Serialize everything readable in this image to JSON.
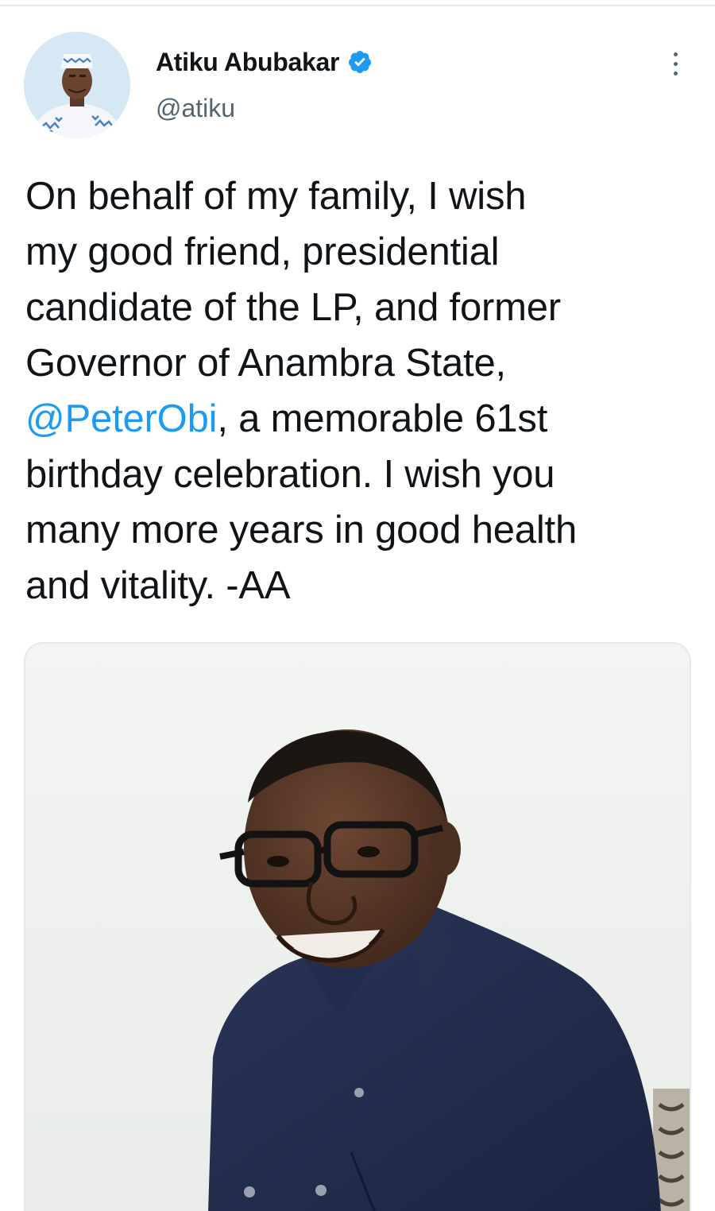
{
  "tweet": {
    "author": {
      "display_name": "Atiku Abubakar",
      "handle": "@atiku",
      "verified": true
    },
    "text_lines": [
      [
        {
          "text": "On behalf of my family, I wish"
        }
      ],
      [
        {
          "text": "my good friend, presidential"
        }
      ],
      [
        {
          "text": "candidate of the LP, and former"
        }
      ],
      [
        {
          "text": "Governor of Anambra State,"
        }
      ],
      [
        {
          "text": "@PeterObi",
          "mention": true
        },
        {
          "text": ", a memorable 61st"
        }
      ],
      [
        {
          "text": "birthday celebration. I wish you"
        }
      ],
      [
        {
          "text": "many more years in good health"
        }
      ],
      [
        {
          "text": "and vitality. -AA"
        }
      ]
    ]
  },
  "icons": {
    "more": "more-vertical-icon",
    "verified": "verified-badge-icon"
  },
  "colors": {
    "mention": "#1d9bf0",
    "verified": "#1d9bf0",
    "secondary_text": "#536471"
  }
}
